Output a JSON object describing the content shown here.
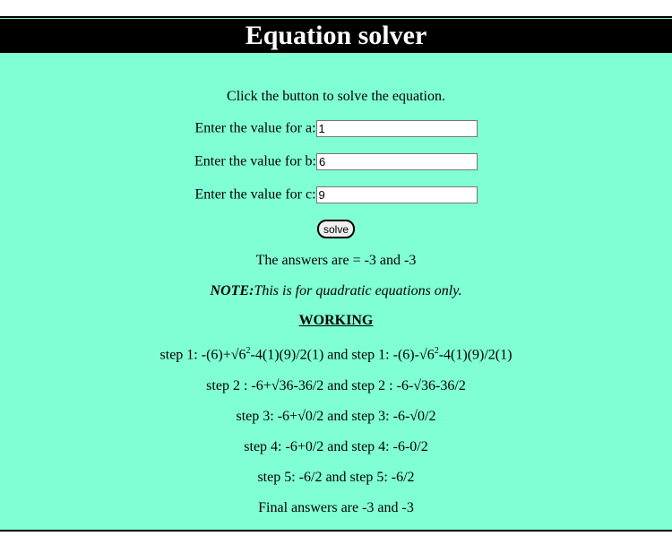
{
  "header": {
    "title": "Equation solver"
  },
  "intro": "Click the button to solve the equation.",
  "fields": [
    {
      "label": "Enter the value for a:",
      "value": "1"
    },
    {
      "label": "Enter the value for b:",
      "value": "6"
    },
    {
      "label": "Enter the value for c:",
      "value": "9"
    }
  ],
  "solve_label": "solve",
  "answers_text": "The answers are = -3 and -3",
  "note": {
    "label": "NOTE:",
    "text": "This is for quadratic equations only."
  },
  "working_heading": "WORKING",
  "steps": {
    "step1_a": "step 1: -(6)+√6",
    "step1_sup_a": "2",
    "step1_b": "-4(1)(9)/2(1) and step 1: -(6)-√6",
    "step1_sup_b": "2",
    "step1_c": "-4(1)(9)/2(1)",
    "step2": "step 2 : -6+√36-36/2 and step 2 : -6-√36-36/2",
    "step3": "step 3: -6+√0/2 and step 3: -6-√0/2",
    "step4": "step 4: -6+0/2 and step 4: -6-0/2",
    "step5": "step 5: -6/2 and step 5: -6/2"
  },
  "final_text": "Final answers are -3 and -3",
  "colors": {
    "background": "#80ffd4",
    "title_bar": "#000000",
    "title_text": "#ffffff"
  }
}
